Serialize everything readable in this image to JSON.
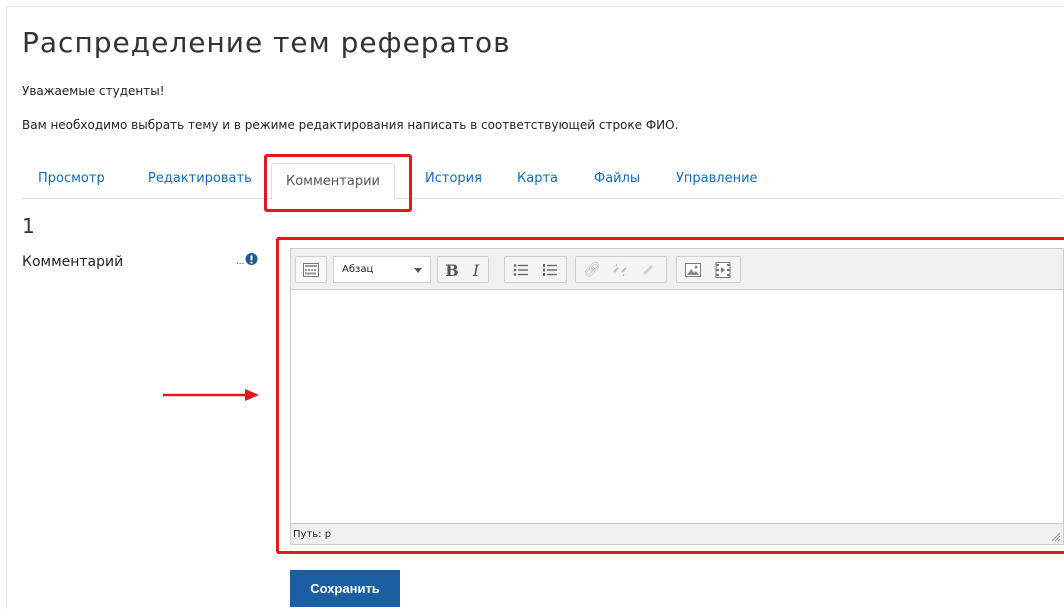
{
  "page": {
    "title": "Распределение тем рефератов",
    "intro_greeting": "Уважаемые студенты!",
    "intro_text": "Вам необходимо выбрать тему и в режиме редактирования написать в соответствующей строке ФИО."
  },
  "tabs": [
    {
      "label": "Просмотр",
      "active": false
    },
    {
      "label": "Редактировать",
      "active": false
    },
    {
      "label": "Комментарии",
      "active": true
    },
    {
      "label": "История",
      "active": false
    },
    {
      "label": "Карта",
      "active": false
    },
    {
      "label": "Файлы",
      "active": false
    },
    {
      "label": "Управление",
      "active": false
    }
  ],
  "entry": {
    "number": "1",
    "field_label": "Комментарий",
    "required_icon": "exclamation-circle-icon"
  },
  "editor": {
    "format_select": "Абзац",
    "path_label": "Путь: p",
    "toolbar_icons": [
      "toolbar-toggle-icon",
      "bold-icon",
      "italic-icon",
      "unordered-list-icon",
      "ordered-list-icon",
      "link-icon",
      "unlink-icon",
      "anchor-icon",
      "image-icon",
      "media-icon"
    ]
  },
  "actions": {
    "save_label": "Сохранить"
  },
  "colors": {
    "link": "#0f6cbf",
    "highlight": "#e01a1a",
    "primary_button": "#1a5fa3"
  }
}
